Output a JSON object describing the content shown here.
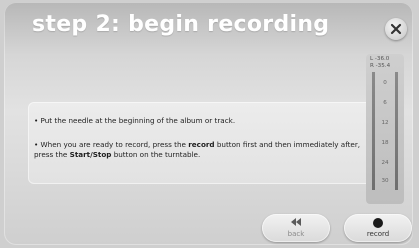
{
  "header": {
    "title": "step 2: begin recording"
  },
  "instructions": {
    "item1": "Put the needle at the beginning of the album or track.",
    "item2_pre": "When you are ready to record, press the ",
    "item2_bold1": "record",
    "item2_mid": " button first and then immediately after, press the ",
    "item2_bold2": "Start/Stop",
    "item2_post": " button on the turntable.",
    "bullet": "•"
  },
  "meter": {
    "left_readout": "L  -36.0",
    "right_readout": "R  -35.4",
    "ticks": [
      "0",
      "6",
      "12",
      "18",
      "24",
      "30"
    ]
  },
  "buttons": {
    "back_label": "back",
    "record_label": "record"
  },
  "icons": {
    "close": "close-icon",
    "back": "rewind-icon",
    "record": "record-dot-icon"
  }
}
